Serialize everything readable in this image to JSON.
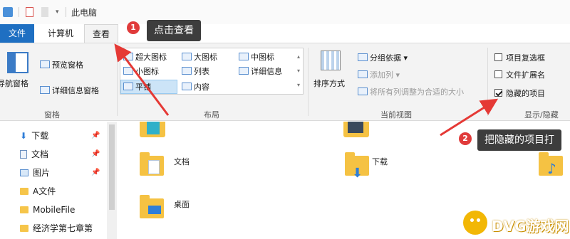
{
  "window": {
    "title": "此电脑"
  },
  "tabs": {
    "file": "文件",
    "computer": "计算机",
    "view": "查看"
  },
  "ribbon": {
    "pane": {
      "nav_pane": "导航窗格",
      "preview_pane": "预览窗格",
      "details_pane": "详细信息窗格",
      "group_label": "窗格"
    },
    "layout": {
      "items": [
        "超大图标",
        "大图标",
        "中图标",
        "小图标",
        "列表",
        "详细信息",
        "平铺",
        "内容"
      ],
      "selected": "平铺",
      "group_label": "布局"
    },
    "current_view": {
      "sort_by": "排序方式",
      "group_by": "分组依据",
      "add_columns": "添加列",
      "fit_columns": "将所有列调整为合适的大小",
      "group_label": "当前视图"
    },
    "show_hide": {
      "item_checkboxes": {
        "label": "项目复选框",
        "checked": false
      },
      "file_extensions": {
        "label": "文件扩展名",
        "checked": false
      },
      "hidden_items": {
        "label": "隐藏的项目",
        "checked": true
      },
      "group_label": "显示/隐藏"
    }
  },
  "sidebar": {
    "items": [
      "下载",
      "文档",
      "图片",
      "A文件",
      "MobileFile",
      "经济学第七章第"
    ]
  },
  "content": {
    "items": [
      "文档",
      "下载",
      "桌面"
    ]
  },
  "annotations": {
    "callout_1": {
      "number": "1",
      "text": "点击查看"
    },
    "callout_2": {
      "number": "2",
      "text": "把隐藏的项目打"
    }
  },
  "watermark": {
    "text": "DVG游戏网"
  },
  "colors": {
    "accent": "#1e6fc2",
    "callout_bg": "#3d3d3d",
    "arrow": "#e53935",
    "badge": "#e03b3b",
    "watermark": "#f2b705"
  }
}
